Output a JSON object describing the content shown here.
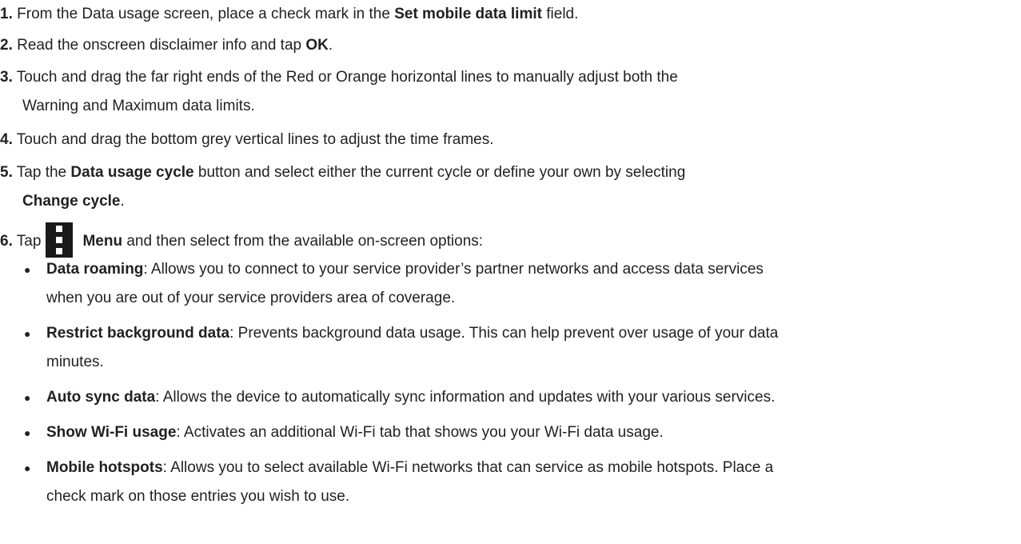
{
  "steps": [
    {
      "num": "1.",
      "pre": " From the Data usage screen, place a check mark in the ",
      "bold": "Set mobile data limit",
      "post": " field."
    },
    {
      "num": "2.",
      "pre": " Read the onscreen disclaimer info and tap ",
      "bold": "OK",
      "post": "."
    },
    {
      "num": "3.",
      "line1": " Touch and drag the far right ends of the Red or Orange horizontal lines to manually adjust both the",
      "line2": "Warning and Maximum data limits."
    },
    {
      "num": "4.",
      "text": " Touch and drag the bottom grey vertical lines to adjust the time frames."
    },
    {
      "num": "5.",
      "pre": " Tap the ",
      "bold": "Data usage cycle",
      "post": " button and select either the current cycle or define your own by selecting",
      "bold2": "Change cycle",
      "post2": "."
    },
    {
      "num": "6.",
      "pre": " Tap",
      "bold": "Menu",
      "post": " and then select from the available on-screen options:"
    }
  ],
  "options": [
    {
      "title": "Data roaming",
      "line1": ": Allows you to connect to your service provider’s partner networks and access data services",
      "line2": "when you are out of your service providers area of coverage."
    },
    {
      "title": "Restrict background data",
      "line1": ": Prevents background data usage. This can help prevent over usage of your data",
      "line2": "minutes."
    },
    {
      "title": "Auto sync data",
      "line1": ": Allows the device to automatically sync information and updates with your various services."
    },
    {
      "title": "Show Wi-Fi usage",
      "line1": ": Activates an additional Wi-Fi tab that shows you your Wi-Fi data usage."
    },
    {
      "title": "Mobile hotspots",
      "line1": ": Allows you to select available Wi-Fi networks that can service as mobile hotspots. Place a",
      "line2": "check mark on those entries you wish to use."
    }
  ],
  "bullet": "●",
  "icons": {
    "menu": "menu-icon"
  }
}
